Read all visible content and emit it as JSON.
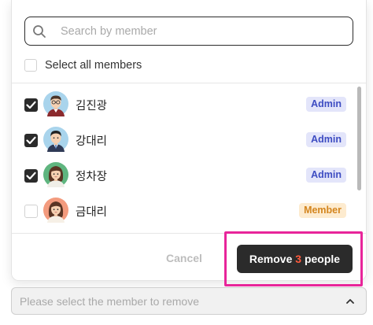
{
  "search": {
    "placeholder": "Search by member"
  },
  "select_all": {
    "label": "Select all members",
    "checked": false
  },
  "members": [
    {
      "name": "김진광",
      "role": "Admin",
      "checked": true,
      "avatar": "avatar-glasses-man-icon"
    },
    {
      "name": "강대리",
      "role": "Admin",
      "checked": true,
      "avatar": "avatar-man-suit-icon"
    },
    {
      "name": "정차장",
      "role": "Admin",
      "checked": true,
      "avatar": "avatar-woman-green-icon"
    },
    {
      "name": "금대리",
      "role": "Member",
      "checked": false,
      "avatar": "avatar-woman-orange-icon"
    }
  ],
  "footer": {
    "cancel_label": "Cancel",
    "remove_prefix": "Remove ",
    "remove_count": "3",
    "remove_suffix": " people"
  },
  "select_field": {
    "placeholder": "Please select the member to remove"
  },
  "colors": {
    "admin_badge_bg": "#e3e5fa",
    "admin_badge_text": "#3d4cc2",
    "member_badge_bg": "#fdebcf",
    "member_badge_text": "#d3851e",
    "primary_button": "#2b2b2b",
    "count_accent": "#ff5a3c",
    "highlight": "#e8259a"
  }
}
